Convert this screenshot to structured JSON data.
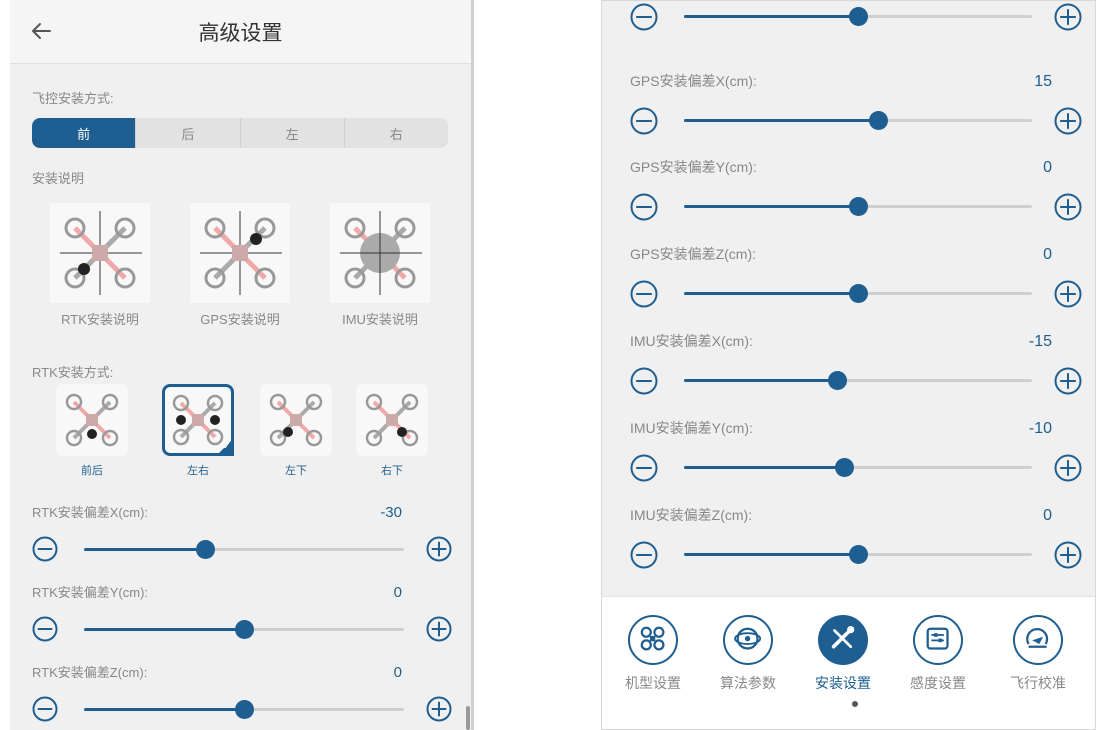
{
  "left": {
    "header": {
      "title": "高级设置"
    },
    "fc_mount": {
      "label": "飞控安装方式:",
      "options": [
        "前",
        "后",
        "左",
        "右"
      ],
      "selected": "前"
    },
    "guide": {
      "label": "安装说明",
      "items": [
        {
          "caption": "RTK安装说明"
        },
        {
          "caption": "GPS安装说明"
        },
        {
          "caption": "IMU安装说明"
        }
      ]
    },
    "rtk_mount": {
      "label": "RTK安装方式:",
      "options": [
        "前后",
        "左右",
        "左下",
        "右下"
      ],
      "selected": "左右"
    },
    "sliders": [
      {
        "label": "RTK安装偏差X(cm):",
        "value": "-30",
        "level": 0.38
      },
      {
        "label": "RTK安装偏差Y(cm):",
        "value": "0",
        "level": 0.5
      },
      {
        "label": "RTK安装偏差Z(cm):",
        "value": "0",
        "level": 0.5
      }
    ]
  },
  "right": {
    "top_slider": {
      "level": 0.5
    },
    "sliders": [
      {
        "label": "GPS安装偏差X(cm):",
        "value": "15",
        "level": 0.56
      },
      {
        "label": "GPS安装偏差Y(cm):",
        "value": "0",
        "level": 0.5
      },
      {
        "label": "GPS安装偏差Z(cm):",
        "value": "0",
        "level": 0.5
      },
      {
        "label": "IMU安装偏差X(cm):",
        "value": "-15",
        "level": 0.44
      },
      {
        "label": "IMU安装偏差Y(cm):",
        "value": "-10",
        "level": 0.46
      },
      {
        "label": "IMU安装偏差Z(cm):",
        "value": "0",
        "level": 0.5
      }
    ],
    "tabs": [
      {
        "label": "机型设置",
        "icon": "drone-frame-icon"
      },
      {
        "label": "算法参数",
        "icon": "algorithm-icon"
      },
      {
        "label": "安装设置",
        "icon": "wrench-screwdriver-icon"
      },
      {
        "label": "感度设置",
        "icon": "sensitivity-icon"
      },
      {
        "label": "飞行校准",
        "icon": "calibration-icon"
      }
    ],
    "active_tab": "安装设置"
  },
  "colors": {
    "accent": "#1f5e90",
    "drone_arm": "#f2a8a8",
    "track": "#cfcfcf"
  }
}
